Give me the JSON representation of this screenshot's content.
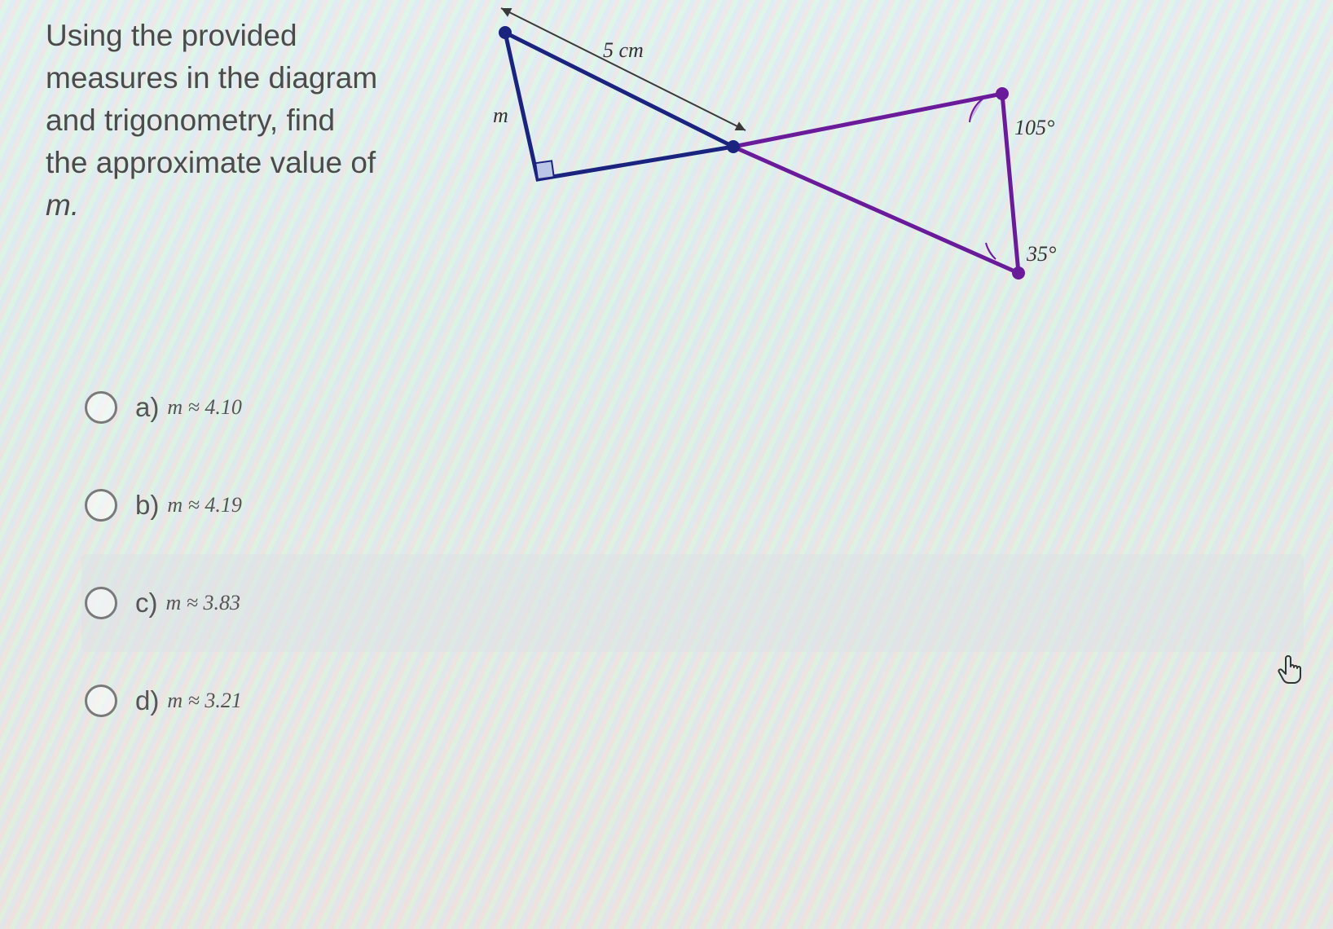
{
  "question": {
    "line1": "Using the provided",
    "line2": "measures in the diagram",
    "line3": "and trigonometry, find",
    "line4": "the approximate value of",
    "variable": "m."
  },
  "diagram": {
    "side_label": "5 cm",
    "m_label": "m",
    "angle_top": "105°",
    "angle_bottom": "35°"
  },
  "options": [
    {
      "letter": "a)",
      "text": "m ≈ 4.10"
    },
    {
      "letter": "b)",
      "text": "m ≈ 4.19"
    },
    {
      "letter": "c)",
      "text": "m ≈ 3.83"
    },
    {
      "letter": "d)",
      "text": "m ≈ 3.21"
    }
  ],
  "hovered_index": 2
}
